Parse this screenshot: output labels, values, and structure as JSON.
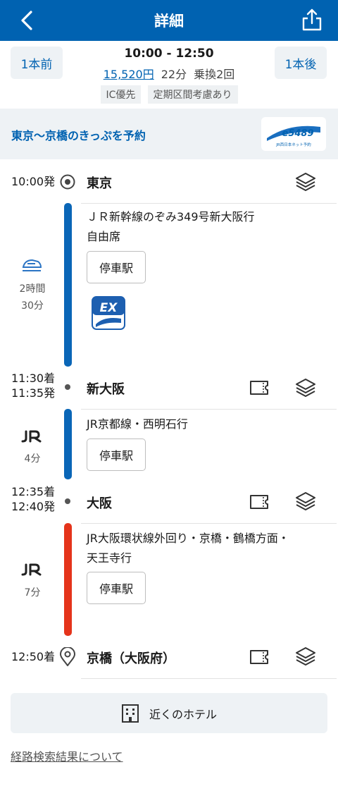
{
  "header": {
    "title": "詳細"
  },
  "summary": {
    "prev_label": "1本前",
    "next_label": "1本後",
    "time_range": "10:00 - 12:50",
    "fare": "15,520円",
    "duration": "22分",
    "transfers": "乗換2回",
    "tags": [
      "IC優先",
      "定期区間考慮あり"
    ]
  },
  "reservation": {
    "label": "東京～京橋のきっぷを予約",
    "logo_text": "e5489",
    "logo_sub": "JR西日本ネット予約"
  },
  "route": {
    "stations": [
      {
        "name": "東京",
        "dep": "10:00発"
      },
      {
        "name": "新大阪",
        "arr": "11:30着",
        "dep": "11:35発"
      },
      {
        "name": "大阪",
        "arr": "12:35着",
        "dep": "12:40発"
      },
      {
        "name": "京橋（大阪府）",
        "arr": "12:50着"
      }
    ],
    "segments": [
      {
        "line": "ＪＲ新幹線のぞみ349号新大阪行",
        "seat": "自由席",
        "duration_hours": "2時間",
        "duration_min": "30分",
        "stops_label": "停車駅",
        "color": "#0a66b7",
        "ex_label": "EX"
      },
      {
        "line": "JR京都線・西明石行",
        "duration": "4分",
        "stops_label": "停車駅",
        "color": "#0a66b7"
      },
      {
        "line": "JR大阪環状線外回り・京橋・鶴橋方面・",
        "line2": "天王寺行",
        "duration": "7分",
        "stops_label": "停車駅",
        "color": "#e5341b"
      }
    ]
  },
  "footer": {
    "hotel_label": "近くのホテル",
    "about_link": "経路検索結果について"
  },
  "colors": {
    "primary": "#0062b1",
    "shinkansen": "#0a66b7",
    "loop": "#e5341b"
  }
}
